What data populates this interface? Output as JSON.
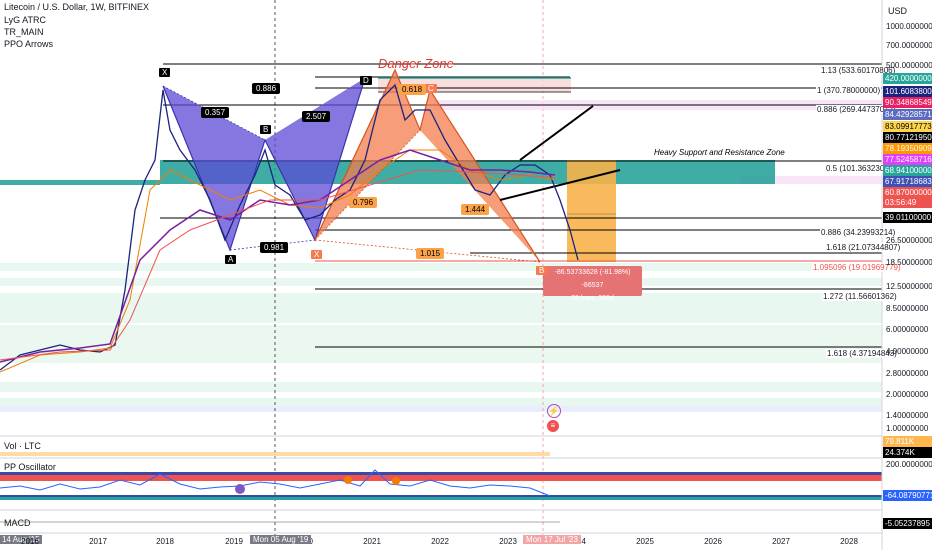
{
  "header": {
    "title": "Litecoin / U.S. Dollar, 1W, BITFINEX",
    "indicators": [
      "LyG ATRC",
      "TR_MAIN",
      "PPO Arrows"
    ],
    "currency": "USD"
  },
  "colors": {
    "up": "#26a69a",
    "down": "#ef5350",
    "harmonic_purple": "#5b4bd6",
    "harmonic_orange": "#f47c4c",
    "support_zone": "#1e9e96",
    "danger_zone": "#e57373"
  },
  "annotations": {
    "danger_zone": "Danger Zone",
    "support_zone": "Heavy Support and Resistance Zone",
    "measure_change": "-86.53733628 (-81.98%) -86537",
    "measure_bars": "38 bars, 266d"
  },
  "harmonic_points": {
    "x1": "X",
    "a1": "A",
    "b1": "B",
    "d1": "D",
    "x2": "X",
    "b2": "B",
    "c2": "C"
  },
  "harmonic_ratios": {
    "r1": "0.886",
    "r2": "0.357",
    "r3": "2.507",
    "r4": "0.981",
    "r5": "0.618",
    "r6": "0.796",
    "r7": "1.015",
    "r8": "1.444"
  },
  "fib_levels": [
    {
      "label": "1.13 (533.60170806)"
    },
    {
      "label": "1 (370.78000000)"
    },
    {
      "label": "0.886 (269.44737072)"
    },
    {
      "label": "0.5 (101.36323080)"
    },
    {
      "label": "0.886 (34.23993214)"
    },
    {
      "label": "1.618 (21.07344807)"
    },
    {
      "label": "1.095096 (19.01969779)"
    },
    {
      "label": "1.272 (11.56601362)"
    },
    {
      "label": "1.618 (4.37194843)"
    }
  ],
  "price_axis": [
    {
      "label": "1000.00000000"
    },
    {
      "label": "700.00000000"
    },
    {
      "label": "500.00000000"
    },
    {
      "label": "26.50000000"
    },
    {
      "label": "18.50000000"
    },
    {
      "label": "12.50000000"
    },
    {
      "label": "8.50000000"
    },
    {
      "label": "6.00000000"
    },
    {
      "label": "4.00000000"
    },
    {
      "label": "2.80000000"
    },
    {
      "label": "2.00000000"
    },
    {
      "label": "1.40000000"
    },
    {
      "label": "1.00000000"
    }
  ],
  "price_tags": [
    {
      "label": "420.00000000",
      "color": "#26a69a"
    },
    {
      "label": "101.60838000",
      "color": "#1a237e"
    },
    {
      "label": "90.34868549",
      "color": "#e91e63"
    },
    {
      "label": "84.42928571",
      "color": "#5c6bc0"
    },
    {
      "label": "83.09917773",
      "color": "#ffd54f"
    },
    {
      "label": "80.77121950",
      "color": "#000000"
    },
    {
      "label": "78.19350909",
      "color": "#ff9800"
    },
    {
      "label": "77.52458716",
      "color": "#e040fb"
    },
    {
      "label": "68.94100000",
      "color": "#26a69a"
    },
    {
      "label": "67.91718683",
      "color": "#3f51b5"
    },
    {
      "label": "60.87000000",
      "color": "#ef5350"
    },
    {
      "label": "03:56:49",
      "color": "#ef5350"
    },
    {
      "label": "39.01100000",
      "color": "#000000"
    }
  ],
  "volume_pane": {
    "label": "Vol · LTC",
    "tags": [
      {
        "label": "79.811K",
        "color": "#ffb74d"
      },
      {
        "label": "24.374K",
        "color": "#000000"
      }
    ]
  },
  "oscillator_pane": {
    "label": "PP Oscillator",
    "axis": "200.00000000",
    "tag": "-64.08790771"
  },
  "macd_pane": {
    "label": "MACD",
    "tag": "-5.05237895"
  },
  "time_axis": {
    "years": [
      "2016",
      "2017",
      "2018",
      "2019",
      "2020",
      "2021",
      "2022",
      "2023",
      "2024",
      "2025",
      "2026",
      "2027",
      "2028"
    ],
    "start_label": "14 Aug '15",
    "cursor_label": "Mon 05 Aug '19",
    "cursor2_label": "Mon 17 Jul '23"
  }
}
